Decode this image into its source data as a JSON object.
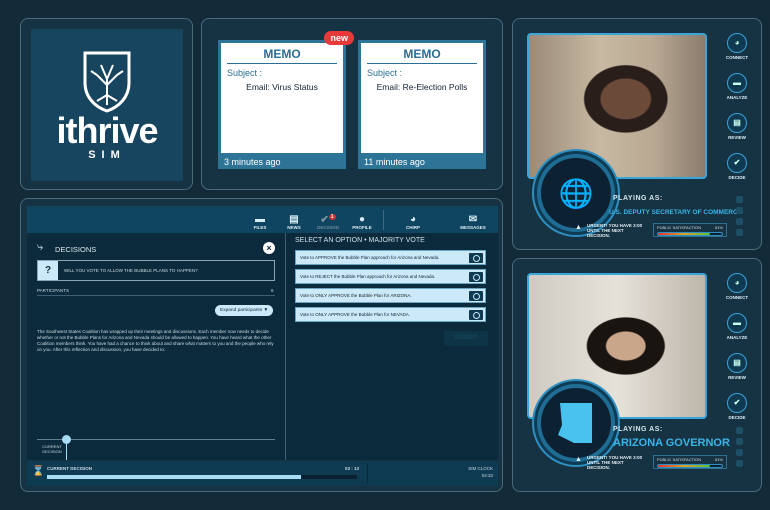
{
  "logo": {
    "word": "ithrive",
    "sub": "SIM"
  },
  "memos": [
    {
      "title": "MEMO",
      "subject_label": "Subject :",
      "subject": "Email: Virus Status",
      "time": "3 minutes ago",
      "badge": "new"
    },
    {
      "title": "MEMO",
      "subject_label": "Subject :",
      "subject": "Email: Re-Election Polls",
      "time": "11 minutes ago"
    }
  ],
  "nav": [
    {
      "label": "FILES",
      "icon": "folder-icon"
    },
    {
      "label": "NEWS",
      "icon": "news-icon"
    },
    {
      "label": "DECISION",
      "icon": "decision-icon",
      "badge": "1"
    },
    {
      "label": "PROFILE",
      "icon": "profile-icon"
    },
    {
      "label": "CHIRP",
      "icon": "chirp-icon"
    },
    {
      "label": "MESSAGES",
      "icon": "envelope-icon"
    }
  ],
  "decisions": {
    "title": "DECISIONS",
    "question": "WILL YOU VOTE TO ALLOW THE BUBBLE PLANS TO HAPPEN?",
    "participants_label": "PARTICIPANTS",
    "participants_count": "6",
    "expand_label": "Expand participants ▼",
    "body": "The Southwest States Coalition has wrapped up their meetings and discussions. Each member now needs to decide whether or not the Bubble Plans for Arizona and Nevada should be allowed to happen. You have heard what the other Coalition members think. You have had a chance to think about and share what matters to you and the people who rely on you. After this reflection and discussion, you have decided to:",
    "timeline_label": "CURRENT DECISION"
  },
  "vote": {
    "title": "SELECT AN OPTION • MAJORITY VOTE",
    "options": [
      "Vote to APPROVE the Bubble Plan approach for Arizona and Nevada.",
      "Vote to REJECT the Bubble Plan approach for Arizona and Nevada.",
      "Vote to ONLY APPROVE the Bubble Plan for ARIZONA.",
      "Vote to ONLY APPROVE the Bubble Plan for NEVADA."
    ],
    "submit": "SUBMIT"
  },
  "status": {
    "label": "CURRENT DECISION",
    "timer": "03 : 13",
    "progress": 0.82,
    "clock_label": "SIM CLOCK",
    "clock": "04:32"
  },
  "players": [
    {
      "playing_label": "PLAYING AS:",
      "role": "U.S. DEPUTY SECRETARY OF COMMERCE",
      "urgent": "URGENT! YOU HAVE 3:00 UNTIL THE NEXT DECISION.",
      "sat_label": "PUBLIC SATISFACTION",
      "sat_value": "81%",
      "satisfaction": 0.81
    },
    {
      "playing_label": "PLAYING AS:",
      "role": "ARIZONA GOVERNOR",
      "urgent": "URGENT! YOU HAVE 3:00 UNTIL THE NEXT DECISION.",
      "sat_label": "PUBLIC SATISFACTION",
      "sat_value": "81%",
      "satisfaction": 0.81
    }
  ],
  "side_buttons": [
    "CONNECT",
    "ANALYZE",
    "REVIEW",
    "DECIDE"
  ],
  "colors": {
    "accent": "#3ba4d8",
    "panel": "#163344",
    "nav": "#0f4560",
    "badge": "#e63a3a"
  }
}
